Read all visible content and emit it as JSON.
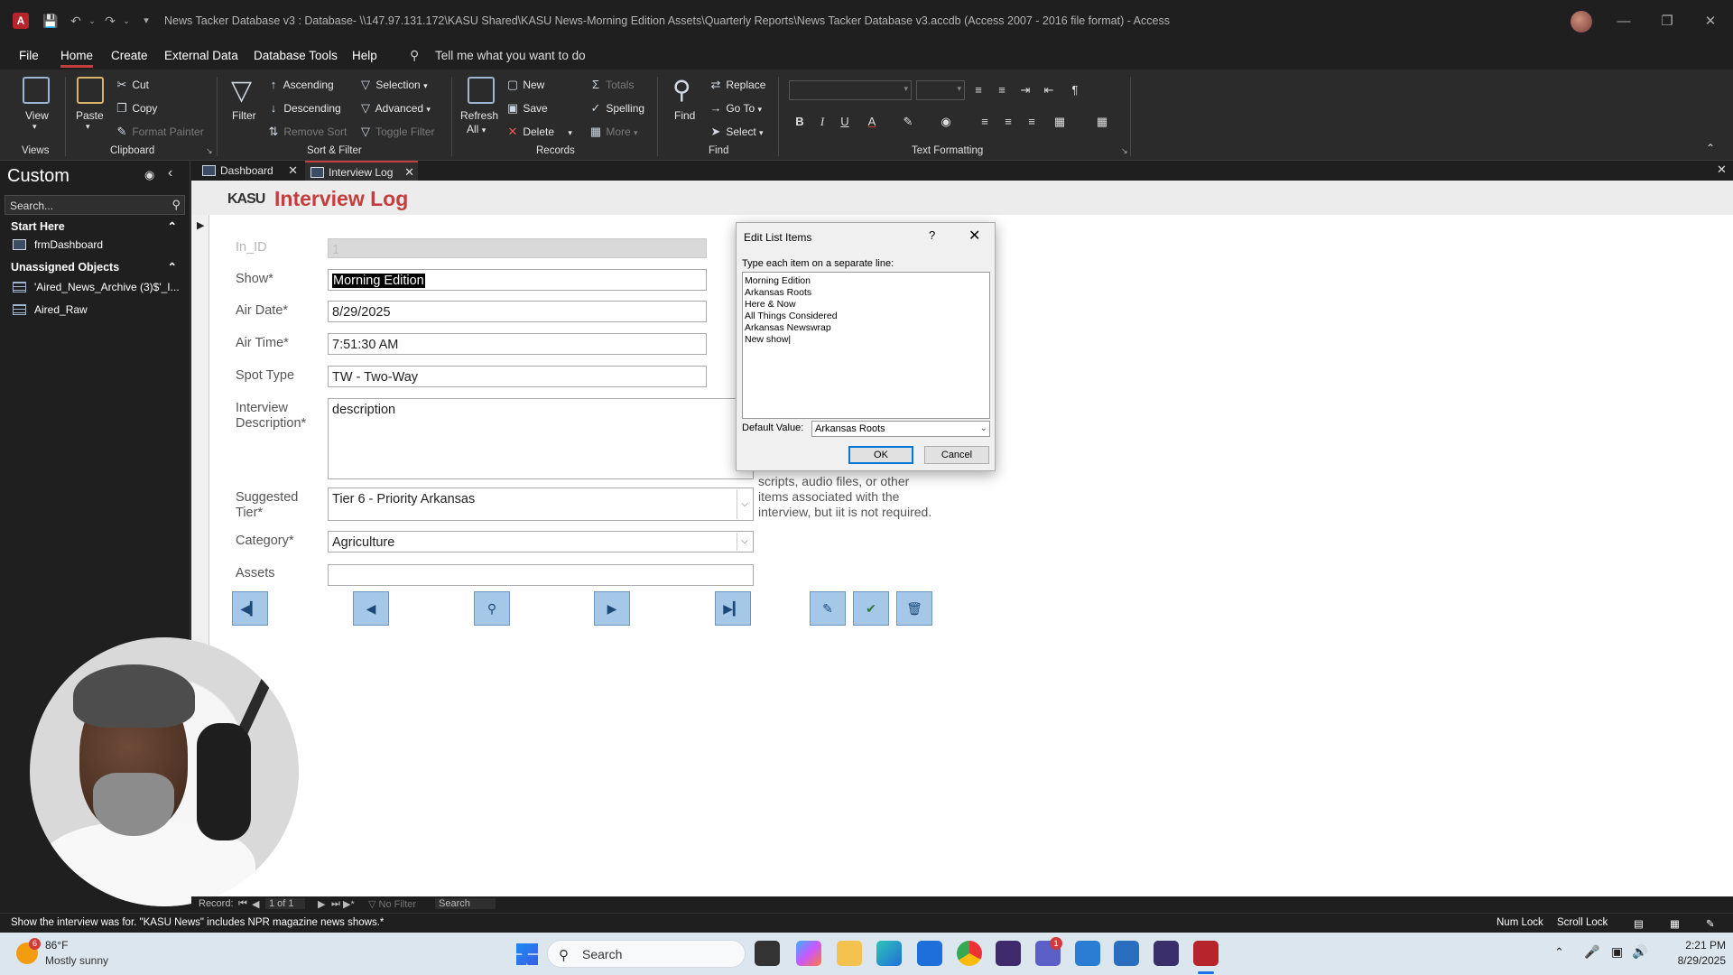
{
  "window": {
    "title": "News Tacker Database v3 : Database- \\\\147.97.131.172\\KASU Shared\\KASU News-Morning Edition Assets\\Quarterly Reports\\News Tacker Database v3.accdb (Access 2007 - 2016 file format)  -  Access",
    "app_icon": "A"
  },
  "ribbon_tabs": [
    "File",
    "Home",
    "Create",
    "External Data",
    "Database Tools",
    "Help"
  ],
  "tell_me": "Tell me what you want to do",
  "ribbon": {
    "views": {
      "view": "View",
      "group": "Views"
    },
    "clipboard": {
      "paste": "Paste",
      "cut": "Cut",
      "copy": "Copy",
      "format_painter": "Format Painter",
      "group": "Clipboard"
    },
    "sort_filter": {
      "filter": "Filter",
      "ascending": "Ascending",
      "descending": "Descending",
      "remove_sort": "Remove Sort",
      "selection": "Selection",
      "advanced": "Advanced",
      "toggle_filter": "Toggle Filter",
      "group": "Sort & Filter"
    },
    "records": {
      "refresh": "Refresh",
      "refresh_all": "All",
      "new": "New",
      "save": "Save",
      "delete": "Delete",
      "totals": "Totals",
      "spelling": "Spelling",
      "more": "More",
      "group": "Records"
    },
    "find": {
      "find": "Find",
      "replace": "Replace",
      "goto": "Go To",
      "select": "Select",
      "group": "Find"
    },
    "text_formatting": {
      "group": "Text Formatting"
    }
  },
  "nav": {
    "title": "Custom",
    "search_placeholder": "Search...",
    "groups": [
      {
        "name": "Start Here",
        "items": [
          "frmDashboard"
        ]
      },
      {
        "name": "Unassigned Objects",
        "items": [
          "'Aired_News_Archive (3)$'_I...",
          "Aired_Raw"
        ]
      }
    ]
  },
  "doc_tabs": [
    "Dashboard",
    "Interview Log"
  ],
  "form": {
    "logo": "KASU",
    "title": "Interview Log",
    "fields": {
      "in_id": {
        "label": "In_ID",
        "value": "1"
      },
      "show": {
        "label": "Show*",
        "value": "Morning Edition"
      },
      "air_date": {
        "label": "Air Date*",
        "value": "8/29/2025"
      },
      "air_time": {
        "label": "Air Time*",
        "value": "7:51:30 AM"
      },
      "spot_type": {
        "label": "Spot Type",
        "value": "TW - Two-Way"
      },
      "description": {
        "label": "Interview Description*",
        "value": "description"
      },
      "tier": {
        "label": "Suggested Tier*",
        "value": "Tier 6 - Priority Arkansas"
      },
      "category": {
        "label": "Category*",
        "value": "Agriculture"
      },
      "assets": {
        "label": "Assets",
        "value": ""
      }
    },
    "help_text": "scripts, audio files, or other items associated with the interview, but iit is not required."
  },
  "dialog": {
    "title": "Edit List Items",
    "help": "?",
    "prompt": "Type each item on a separate line:",
    "items": [
      "Morning Edition",
      "Arkansas Roots",
      "Here & Now",
      "All Things Considered",
      "Arkansas Newswrap",
      "New show|"
    ],
    "default_label": "Default Value:",
    "default_value": "Arkansas Roots",
    "ok": "OK",
    "cancel": "Cancel"
  },
  "record_nav": {
    "label": "Record:",
    "position": "1 of 1",
    "filter": "No Filter",
    "search": "Search"
  },
  "status": {
    "message": "Show the interview was for.  \"KASU News\" includes NPR magazine news shows.*",
    "num_lock": "Num Lock",
    "scroll_lock": "Scroll Lock"
  },
  "taskbar": {
    "weather_badge": "6",
    "temperature": "86°F",
    "weather": "Mostly sunny",
    "search": "Search",
    "teams_badge": "1",
    "time": "2:21 PM",
    "date": "8/29/2025"
  }
}
